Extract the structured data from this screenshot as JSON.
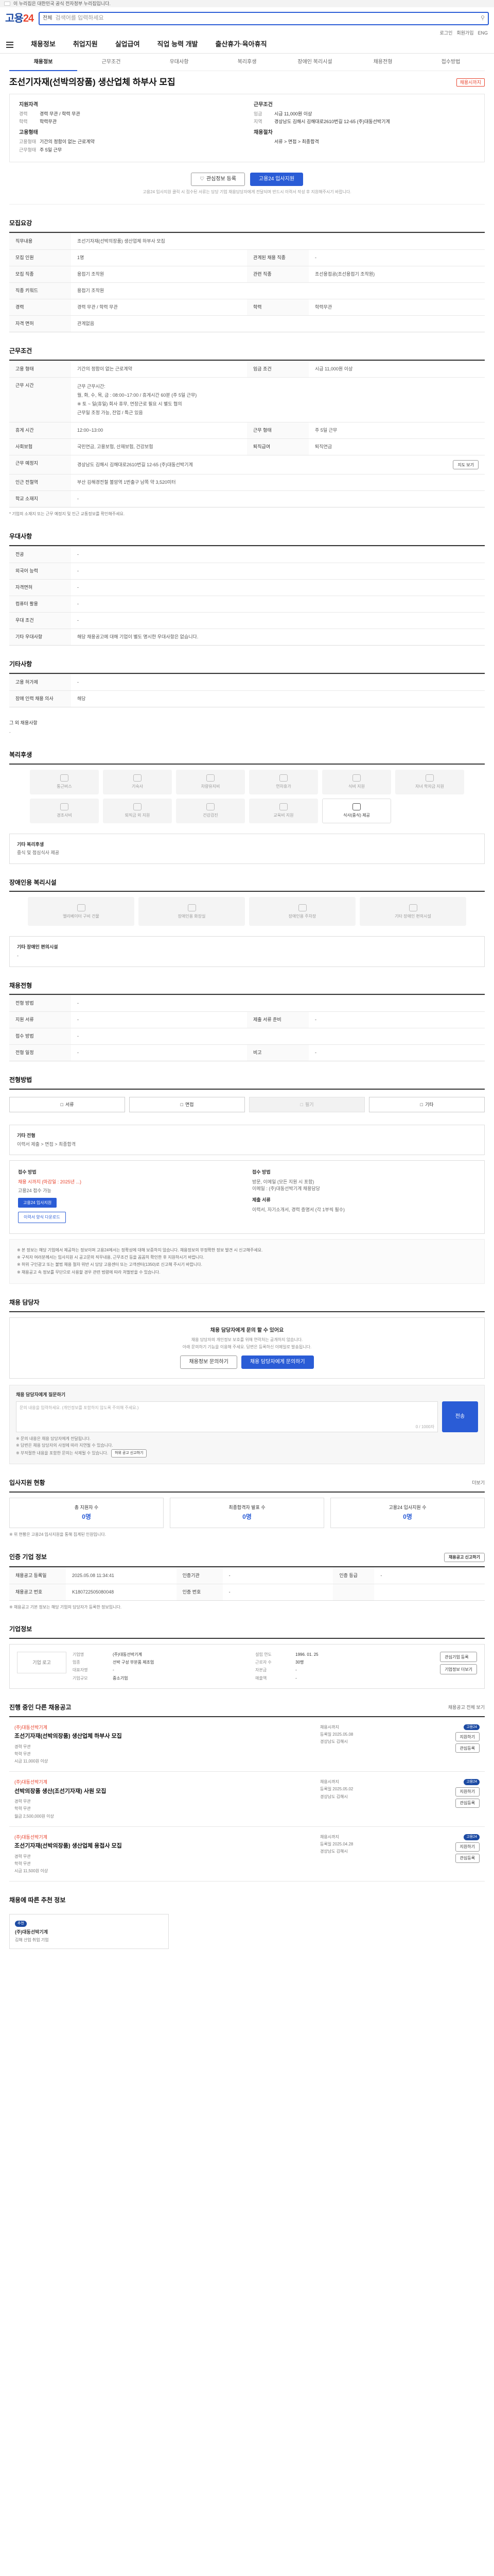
{
  "gov_banner": "이 누리집은 대한민국 공식 전자정부 누리집입니다.",
  "logo": {
    "g": "고용",
    "s": "24"
  },
  "search": {
    "category": "전체",
    "placeholder": "검색어를 입력하세요"
  },
  "topnav": [
    "로그인",
    "회원가입",
    "ENG"
  ],
  "mainnav": [
    "채용정보",
    "취업지원",
    "실업급여",
    "직업 능력 개발",
    "출산휴가·육아휴직"
  ],
  "subnav": [
    "채용정보",
    "근무조건",
    "우대사항",
    "복리후생",
    "장애인 복리시설",
    "채용전형",
    "접수방법"
  ],
  "job": {
    "title": "조선기자재(선박의장품) 생산업체 하부사 모집",
    "badge": "채용시까지",
    "summary": {
      "left_title": "지원자격",
      "left": [
        {
          "k": "경력",
          "v": "경력 무관 / 학력 무관"
        },
        {
          "k": "학력",
          "v": "학력무관"
        }
      ],
      "left_title2": "고용형태",
      "left2": [
        {
          "k": "고용형태",
          "v": "기간의 정함이 없는 근로계약"
        },
        {
          "k": "근무형태",
          "v": "주 5일 근무"
        }
      ],
      "right_title": "근무조건",
      "right": [
        {
          "k": "임금",
          "v": "시급 11,000원 이상"
        },
        {
          "k": "지역",
          "v": "경상남도 김해시 김해대로2610번길 12-65 (주)대동선박기계"
        }
      ],
      "right_title2": "채용절차",
      "right2": [
        {
          "k": "",
          "v": "서류 > 면접 > 최종합격"
        }
      ]
    },
    "actions": {
      "scrap": "관심정보 등록",
      "apply": "고용24 입사지원"
    },
    "action_note": "고용24 입사지원 클릭 시 접수된 서류는 담당 기업 채용담당자에게 전달되며 반드시 이력서 작성 후 지원해주시기 바랍니다."
  },
  "qualification": {
    "title": "모집요강",
    "head_k": "직무내용",
    "head_v": "조선기자재(선박의장품) 생산업체 하부사 모집",
    "rows": [
      [
        "모집 인원",
        "1명",
        "관계된 채용 직종",
        "-"
      ],
      [
        "모집 직종",
        "용접기 조작원",
        "관련 직종",
        "조선용접공(조선용접기 조작원)"
      ],
      [
        "직종 키워드",
        "용접기 조작원",
        "",
        ""
      ],
      [
        "경력",
        "경력 무관 / 학력 무관",
        "학력",
        "학력무관"
      ],
      [
        "자격 면허",
        "관계없음",
        "",
        ""
      ]
    ]
  },
  "conditions": {
    "title": "근무조건",
    "rows1": [
      [
        "고용 형태",
        "기간의 정함이 없는 근로계약",
        "임금 조건",
        "시급 11,000원 이상"
      ]
    ],
    "worktime_k": "근무 시간",
    "worktime_v": [
      "근무 근무시간:",
      "월, 화, 수, 목, 금 : 08:00~17:00 / 휴게시간 60분 (주 5일 근무)",
      "※ 토 ~ 일(휴일) 회사 휴무, 연장근로 필요 시 별도 협의",
      "근무일 조정 가능, 잔업 / 특근 있음"
    ],
    "rows2": [
      [
        "휴게 시간",
        "12:00~13:00",
        "근무 형태",
        "주 5일 근무"
      ],
      [
        "사회보험",
        "국민연금, 고용보험, 산재보험, 건강보험",
        "퇴직급여",
        "퇴직연금"
      ],
      [
        "근무 예정지",
        "경상남도 김해시 김해대로2610번길 12-65 (주)대동선박기계",
        "",
        ""
      ],
      [
        "인근 전철역",
        "부산 김해경전철 불암역 1번출구 남쪽 약 3,520미터",
        "",
        ""
      ],
      [
        "학교 소재지",
        "-",
        "",
        ""
      ]
    ],
    "map_button": "지도 보기",
    "footnote": "* 기업의 소재지 또는 근무 예정지 및 인근 교통정보를 확인해주세요."
  },
  "preference": {
    "title": "우대사항",
    "rows": [
      [
        "전공",
        "-"
      ],
      [
        "외국어 능력",
        "-"
      ],
      [
        "자격면허",
        "-"
      ],
      [
        "컴퓨터 활용",
        "-"
      ],
      [
        "우대 조건",
        "-"
      ],
      [
        "기타 우대사항",
        "해당 채용공고에 대해 기업이 별도 명시한 우대사항은 없습니다."
      ]
    ]
  },
  "other": {
    "title": "기타사항",
    "rows": [
      [
        "고용 허가제",
        "-"
      ],
      [
        "장애 인력 채용 의사",
        "해당"
      ]
    ]
  },
  "requirement": {
    "label": "그 외 채용사항",
    "value": "-"
  },
  "welfare": {
    "title": "복리후생",
    "items": [
      "통근버스",
      "기숙사",
      "차량유지비",
      "연차휴가",
      "식비 지원",
      "자녀 학자금 지원",
      "경조사비",
      "퇴직금 외 지원",
      "건강검진",
      "교육비 지원",
      "식사(중식) 제공"
    ],
    "on_index": 10,
    "other_label": "기타 복리후생",
    "other_value": "중식 및 점심식사 제공"
  },
  "disability": {
    "title": "장애인용 복리시설",
    "items": [
      "엘리베이터 구비 건물",
      "장애인용 화장실",
      "장애인용 주차장",
      "기타 장애인 편의시설"
    ],
    "other_label": "기타 장애인 편의시설",
    "other_value": "-"
  },
  "process": {
    "title": "채용전형",
    "rows": [
      [
        "전형 방법",
        "-",
        "",
        ""
      ],
      [
        "지원 서류",
        "-",
        "제출 서류 준비",
        "-"
      ],
      [
        "접수 방법",
        "-",
        "",
        ""
      ],
      [
        "전형 일정",
        "-",
        "비고",
        "-"
      ]
    ]
  },
  "method": {
    "title": "전형방법",
    "items": [
      "서류",
      "면접",
      "필기",
      "기타"
    ],
    "off_index": 2,
    "other_label": "기타 전형",
    "other_value": "이력서 제출 > 면접 > 최종합격"
  },
  "apply_info": {
    "label1": "접수 방법",
    "v1_red": "채용 시까지 (마감일 : 2025년 ...)",
    "v1": "고용24 접수 가능",
    "label2": "접수 방법",
    "v2": "방문, 이메일 (모든 지원 시 포함)",
    "v2b": "이메일 : (주)대동선박기계 채용담당",
    "label3": "제출 서류",
    "v3": "이력서, 자기소개서, 경력 증명서 (각 1부씩 필수)",
    "btn1": "고용24 입사지원",
    "btn2": "이력서 양식 다운로드"
  },
  "notice": [
    "※ 본 정보는 해당 기업에서 제공하는 정보이며 고용24에서는 정확성에 대해 보증하지 않습니다. 채용정보의 부정확한 정보 발견 시 신고해주세요.",
    "※ 구직자 여러분께서는 입사지원 시 공고문의 직무내용, 근무조건 등을 꼼꼼히 확인한 후 지원하시기 바랍니다.",
    "※ 허위 구인광고 또는 불법 채용 절차 위반 시 담당 고용센터 또는 고객센터(1350)로 신고해 주시기 바랍니다.",
    "※ 채용공고 속 정보를 무단으로 사용할 경우 관련 법령에 따라 처벌받을 수 있습니다."
  ],
  "contact": {
    "title": "채용 담당자",
    "box_title": "채용 담당자에게 문의 할 수 있어요",
    "box_sub1": "채용 담당자의 개인정보 보호를 위해 연락처는 공개하지 않습니다.",
    "box_sub2": "아래 문의하기 기능을 이용해 주세요. 답변은 등록하신 이메일로 발송됩니다.",
    "btn1": "채용정보 문의하기",
    "btn2": "채용 담당자에게 문의하기",
    "q_title": "채용 담당자에게 질문하기",
    "q_placeholder": "문의 내용을 입력하세요. (개인정보를 포함하지 않도록 주의해 주세요.)",
    "q_count": "0 / 1000자",
    "q_send": "전송",
    "q_notes": [
      "※ 문의 내용은 채용 담당자에게 전달됩니다.",
      "※ 답변은 채용 담당자의 사정에 따라 지연될 수 있습니다.",
      "※ 부적절한 내용을 포함한 문의는 삭제될 수 있습니다."
    ],
    "q_report": "허위 공고 신고하기"
  },
  "applicants": {
    "title": "입사지원 현황",
    "more": "더보기",
    "stats": [
      {
        "label": "총 지원자 수",
        "value": "0명"
      },
      {
        "label": "최종합격자 발표 수",
        "value": "0명"
      },
      {
        "label": "고용24 입사지원 수",
        "value": "0명"
      }
    ],
    "note": "※ 위 현황은 고용24 입사지원을 통해 집계된 인원입니다."
  },
  "management": {
    "title": "인증 기업 정보",
    "rows": [
      [
        "채용공고 등록일",
        "2025.05.08 11:34:41",
        "인증기관",
        "-",
        "인증 등급",
        "-"
      ],
      [
        "채용공고 번호",
        "K180722505080048",
        "인증 번호",
        "-",
        "",
        ""
      ]
    ],
    "report_btn": "채용공고 신고하기",
    "notes": [
      "※ 채용공고 기본 정보는 해당 기업의 담당자가 등록한 정보입니다."
    ]
  },
  "company": {
    "title": "기업정보",
    "logo": "기업 로고",
    "rows": [
      [
        "기업명",
        "(주)대동선박기계",
        "설립 연도",
        "1996. 01. 25"
      ],
      [
        "업종",
        "선박 구성 부분품 제조업",
        "근로자 수",
        "30명"
      ],
      [
        "대표자명",
        "-",
        "자본금",
        "-"
      ],
      [
        "기업규모",
        "중소기업",
        "매출액",
        "-"
      ]
    ],
    "btn1": "관심기업 등록",
    "btn2": "기업정보 더보기"
  },
  "related": {
    "title": "진행 중인 다른 채용공고",
    "more": "채용공고 전체 보기",
    "items": [
      {
        "company": "(주)대동선박기계",
        "title": "조선기자재(선박의장품) 생산업체 하부사 모집",
        "tags": [
          "경력 무관",
          "학력 무관",
          "시급 11,000원 이상"
        ],
        "meta": [
          "채용시까지",
          "등록일 2025.05.08",
          "경상남도 김해시"
        ],
        "btn1": "지원하기",
        "btn2": "관심등록",
        "chip": "고용24"
      },
      {
        "company": "(주)대동선박기계",
        "title": "선박의장품 생산(조선기자재) 사원 모집",
        "tags": [
          "경력 무관",
          "학력 무관",
          "월급 2,500,000원 이상"
        ],
        "meta": [
          "채용시까지",
          "등록일 2025.05.02",
          "경상남도 김해시"
        ],
        "btn1": "지원하기",
        "btn2": "관심등록",
        "chip": "고용24"
      },
      {
        "company": "(주)대동선박기계",
        "title": "조선기자재(선박의장품) 생산업체 용접사 모집",
        "tags": [
          "경력 무관",
          "학력 무관",
          "시급 11,500원 이상"
        ],
        "meta": [
          "채용시까지",
          "등록일 2025.04.28",
          "경상남도 김해시"
        ],
        "btn1": "지원하기",
        "btn2": "관심등록",
        "chip": "고용24"
      }
    ]
  },
  "recommend": {
    "title": "채용에 따른 추천 정보",
    "chip": "추천",
    "company": "(주)대동선박기계",
    "desc": "김해 산업 취업 기업"
  }
}
